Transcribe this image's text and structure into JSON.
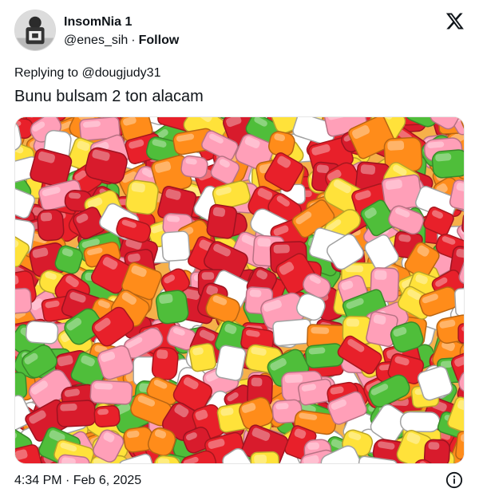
{
  "author": {
    "display_name": "InsomNia 1",
    "handle": "@enes_sih",
    "separator": "·",
    "follow_label": "Follow"
  },
  "reply": {
    "text": "Replying to @dougjudy31"
  },
  "tweet": {
    "text": "Bunu bulsam 2 ton alacam"
  },
  "media": {
    "subject": "candy-pile-photo",
    "candy_colors": [
      "#e8202a",
      "#4fbe3a",
      "#ffe23a",
      "#ff8c1a",
      "#ff9fb8",
      "#ffffff",
      "#d81b2c"
    ]
  },
  "footer": {
    "timestamp": "4:34 PM · Feb 6, 2025"
  },
  "icons": {
    "brand": "x-logo-icon",
    "info": "info-icon"
  }
}
